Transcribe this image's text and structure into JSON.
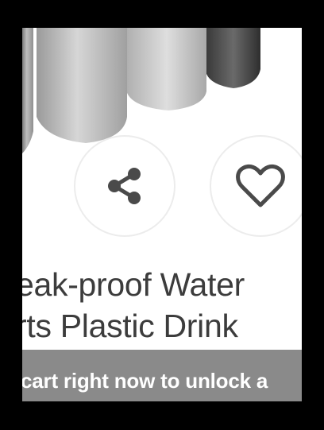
{
  "product": {
    "title_line_1": "eak-proof Water",
    "title_line_2": "rts Plastic Drink",
    "image_description_icon": "water-bottles-image"
  },
  "actions": {
    "share_icon": "share-icon",
    "wishlist_icon": "heart-icon"
  },
  "promo": {
    "text": "cart right now to unlock a"
  },
  "colors": {
    "background": "#ffffff",
    "frame": "#000000",
    "title_text": "#3c3c3c",
    "banner": "#8a8a8a",
    "banner_text": "#ffffff",
    "icon": "#4a4a4a",
    "circle_border": "#ececec"
  }
}
